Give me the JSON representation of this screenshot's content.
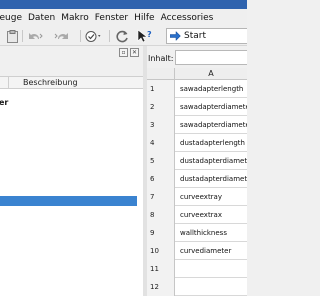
{
  "menubar": {
    "items": [
      "ieuge",
      "Daten",
      "Makro",
      "Fenster",
      "Hilfe",
      "Accessories"
    ]
  },
  "toolbar": {
    "nav_label": "Start",
    "icons": [
      "clipboard-icon",
      "undo-icon",
      "redo-icon",
      "record-icon",
      "refresh-icon",
      "help-cursor-icon",
      "arrow-right-icon"
    ]
  },
  "left_panel": {
    "column_header": "Beschreibung",
    "tree_item": "apter"
  },
  "right_panel": {
    "content_label": "Inhalt:",
    "sheet": {
      "column_header": "A",
      "rows": [
        {
          "num": "1",
          "value": "sawadapterlength"
        },
        {
          "num": "2",
          "value": "sawadapterdiameterext"
        },
        {
          "num": "3",
          "value": "sawadapterdiameterint"
        },
        {
          "num": "4",
          "value": "dustadapterlength"
        },
        {
          "num": "5",
          "value": "dustadapterdiameterext"
        },
        {
          "num": "6",
          "value": "dustadapterdiameterint"
        },
        {
          "num": "7",
          "value": "curveextray"
        },
        {
          "num": "8",
          "value": "curveextrax"
        },
        {
          "num": "9",
          "value": "wallthickness"
        },
        {
          "num": "10",
          "value": "curvediameter"
        },
        {
          "num": "11",
          "value": ""
        },
        {
          "num": "12",
          "value": ""
        }
      ]
    }
  },
  "colors": {
    "title_bar": "#2f63ae",
    "selection": "#3a83d0"
  }
}
